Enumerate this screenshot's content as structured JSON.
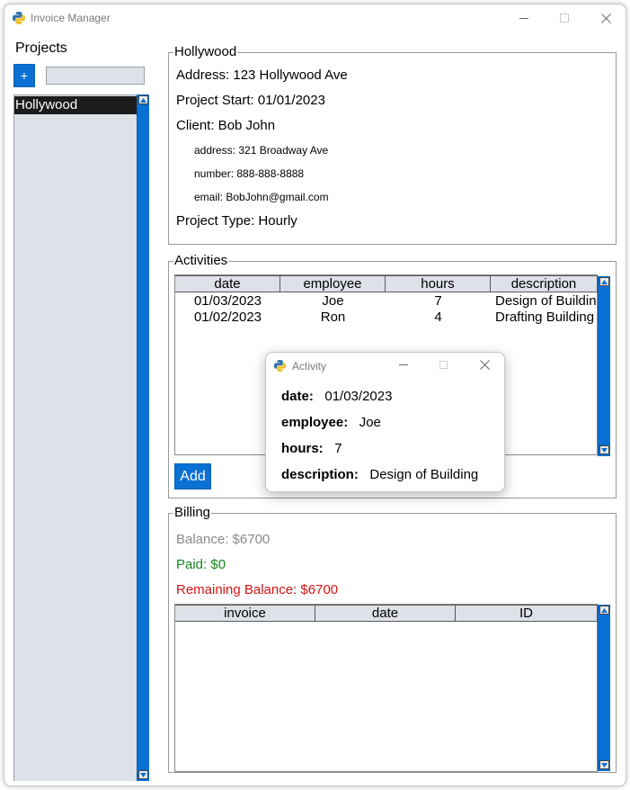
{
  "window": {
    "title": "Invoice Manager"
  },
  "sidebar": {
    "projects_label": "Projects",
    "add_button_label": "+",
    "search_value": "",
    "items": [
      {
        "label": "Hollywood",
        "selected": true
      }
    ]
  },
  "project": {
    "name": "Hollywood",
    "address": "Address: 123 Hollywood Ave",
    "start": "Project Start: 01/01/2023",
    "client": "Client: Bob John",
    "client_address": "address: 321 Broadway Ave",
    "client_number": "number: 888-888-8888",
    "client_email": "email: BobJohn@gmail.com",
    "type": "Project Type: Hourly"
  },
  "activities": {
    "title": "Activities",
    "columns": [
      "date",
      "employee",
      "hours",
      "description"
    ],
    "rows": [
      {
        "date": "01/03/2023",
        "employee": "Joe",
        "hours": "7",
        "description": "Design of Building"
      },
      {
        "date": "01/02/2023",
        "employee": "Ron",
        "hours": "4",
        "description": "Drafting Building"
      }
    ],
    "add_button_label": "Add"
  },
  "billing": {
    "title": "Billing",
    "balance": "Balance: $6700",
    "paid": "Paid: $0",
    "remaining": "Remaining Balance: $6700",
    "columns": [
      "invoice",
      "date",
      "ID"
    ],
    "rows": []
  },
  "dialog": {
    "title": "Activity",
    "fields": [
      {
        "key": "date:",
        "value": "01/03/2023"
      },
      {
        "key": "employee:",
        "value": "Joe"
      },
      {
        "key": "hours:",
        "value": "7"
      },
      {
        "key": "description:",
        "value": "Design of Building"
      }
    ]
  },
  "colors": {
    "accent": "#0a70d3",
    "list_bg": "#dde1e8",
    "paid": "#17851c",
    "remaining": "#d41414",
    "balance": "#8a8a8a"
  },
  "icons": {
    "app": "python-icon",
    "minimize": "minimize-icon",
    "maximize": "maximize-icon",
    "close": "close-icon"
  }
}
